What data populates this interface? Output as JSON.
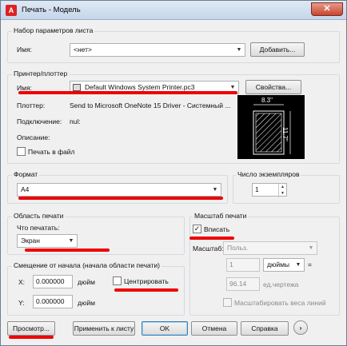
{
  "window": {
    "title": "Печать - Модель",
    "close": "✕"
  },
  "page_setup": {
    "group": "Набор параметров листа",
    "name_label": "Имя:",
    "name_value": "<нет>",
    "add_button": "Добавить..."
  },
  "printer": {
    "group": "Принтер/плоттер",
    "name_label": "Имя:",
    "name_value": "Default Windows System Printer.pc3",
    "properties_button": "Свойства...",
    "plotter_label": "Плоттер:",
    "plotter_value": "Send to Microsoft OneNote 15 Driver - Системный ...",
    "connection_label": "Подключение:",
    "connection_value": "nul:",
    "description_label": "Описание:",
    "print_to_file": "Печать в файл",
    "preview_width": "8.3\"",
    "preview_height": "11.7\""
  },
  "format": {
    "group": "Формат",
    "value": "A4"
  },
  "copies": {
    "group": "Число экземпляров",
    "value": "1"
  },
  "print_area": {
    "group": "Область печати",
    "what_label": "Что печатать:",
    "what_value": "Экран"
  },
  "offset": {
    "group": "Смещение от начала (начала области печати)",
    "x_label": "X:",
    "x_value": "0.000000",
    "x_unit": "дюйм",
    "y_label": "Y:",
    "y_value": "0.000000",
    "y_unit": "дюйм",
    "center": "Центрировать"
  },
  "scale": {
    "group": "Масштаб печати",
    "fit": "Вписать",
    "scale_label": "Масштаб:",
    "scale_value": "Польз.",
    "value1": "1",
    "unit1": "дюймы",
    "equals": "=",
    "value2": "96.14",
    "unit2": "ед.чертежа",
    "lineweights": "Масштабировать веса линий"
  },
  "buttons": {
    "preview": "Просмотр...",
    "apply": "Применить к листу",
    "ok": "OK",
    "cancel": "Отмена",
    "help": "Справка",
    "more": "›"
  },
  "colors": {
    "annotation_red": "#e00000",
    "title_bar": "#c5d6ea"
  }
}
